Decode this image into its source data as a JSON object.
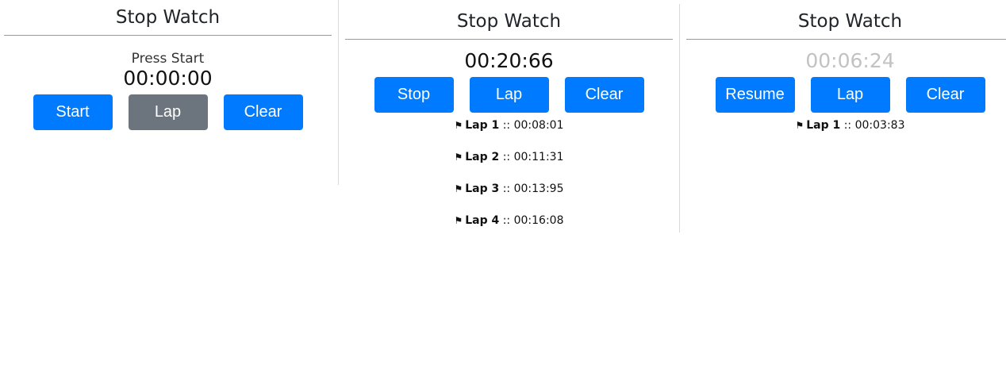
{
  "panels": [
    {
      "title": "Stop Watch",
      "hint": "Press Start",
      "time": "00:00:00",
      "buttons": [
        "Start",
        "Lap",
        "Clear"
      ],
      "laps": []
    },
    {
      "title": "Stop Watch",
      "time": "00:20:66",
      "buttons": [
        "Stop",
        "Lap",
        "Clear"
      ],
      "laps": [
        {
          "label": "Lap 1",
          "sep": "::",
          "time": "00:08:01"
        },
        {
          "label": "Lap 2",
          "sep": "::",
          "time": "00:11:31"
        },
        {
          "label": "Lap 3",
          "sep": "::",
          "time": "00:13:95"
        },
        {
          "label": "Lap 4",
          "sep": "::",
          "time": "00:16:08"
        }
      ]
    },
    {
      "title": "Stop Watch",
      "time": "00:06:24",
      "buttons": [
        "Resume",
        "Lap",
        "Clear"
      ],
      "laps": [
        {
          "label": "Lap 1",
          "sep": "::",
          "time": "00:03:83"
        }
      ]
    }
  ],
  "icons": {
    "lap_flag": "flag-icon"
  },
  "colors": {
    "primary": "#007bff",
    "disabled": "#6c757d",
    "paused_time": "#c2c2c2"
  }
}
